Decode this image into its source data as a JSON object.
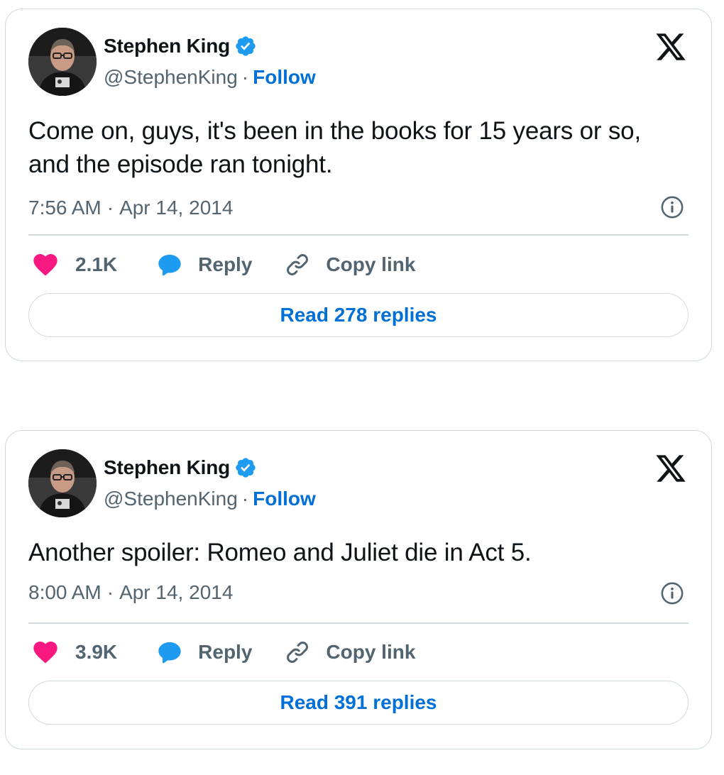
{
  "tweets": [
    {
      "author_name": "Stephen King",
      "handle": "@StephenKing",
      "separator": "·",
      "follow_label": "Follow",
      "text": "Come on, guys, it's been in the books for 15 years or so, and the episode ran tonight.",
      "time": "7:56 AM",
      "date": "Apr 14, 2014",
      "likes": "2.1K",
      "reply_label": "Reply",
      "copy_label": "Copy link",
      "read_replies": "Read 278 replies"
    },
    {
      "author_name": "Stephen King",
      "handle": "@StephenKing",
      "separator": "·",
      "follow_label": "Follow",
      "text": "Another spoiler: Romeo and Juliet die in Act 5.",
      "time": "8:00 AM",
      "date": "Apr 14, 2014",
      "likes": "3.9K",
      "reply_label": "Reply",
      "copy_label": "Copy link",
      "read_replies": "Read 391 replies"
    }
  ],
  "icons": {
    "verified": "verified-badge-icon",
    "x_logo": "x-logo-icon",
    "info": "info-icon",
    "like": "heart-icon",
    "reply": "speech-bubble-icon",
    "copy": "link-icon"
  },
  "colors": {
    "link_blue": "#006fd6",
    "verified_blue": "#1d9bf0",
    "like_pink": "#f91880",
    "text_primary": "#0f1419",
    "text_secondary": "#536471",
    "border": "#cfd9de"
  }
}
